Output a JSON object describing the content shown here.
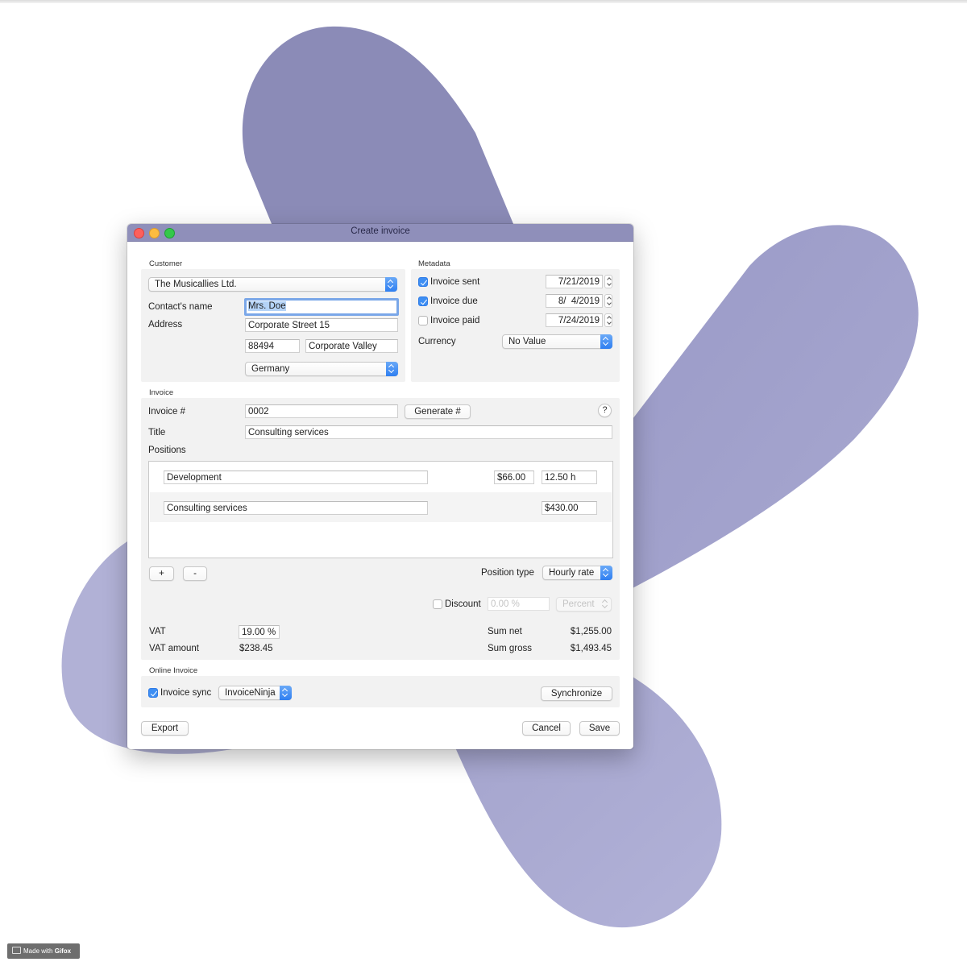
{
  "window": {
    "title": "Create invoice"
  },
  "customer": {
    "section_label": "Customer",
    "selected": "The Musicallies Ltd.",
    "contact_label": "Contact's name",
    "contact_value": "Mrs. Doe",
    "address_label": "Address",
    "street": "Corporate Street 15",
    "zip": "88494",
    "city": "Corporate Valley",
    "country": "Germany"
  },
  "metadata": {
    "section_label": "Metadata",
    "sent": {
      "label": "Invoice sent",
      "checked": true,
      "date": "7/21/2019"
    },
    "due": {
      "label": "Invoice due",
      "checked": true,
      "date": "8/  4/2019"
    },
    "paid": {
      "label": "Invoice paid",
      "checked": false,
      "date": "7/24/2019"
    },
    "currency_label": "Currency",
    "currency_value": "No Value"
  },
  "invoice": {
    "section_label": "Invoice",
    "number_label": "Invoice #",
    "number_value": "0002",
    "generate_button": "Generate #",
    "help_button": "?",
    "title_label": "Title",
    "title_value": "Consulting services",
    "positions_label": "Positions",
    "positions": [
      {
        "description": "Development",
        "rate": "$66.00",
        "quantity": "12.50 h"
      },
      {
        "description": "Consulting services",
        "amount": "$430.00"
      }
    ],
    "add_button": "+",
    "remove_button": "-",
    "position_type_label": "Position type",
    "position_type_value": "Hourly rate",
    "discount_label": "Discount",
    "discount_checked": false,
    "discount_placeholder": "0.00 %",
    "discount_type": "Percent",
    "vat_label": "VAT",
    "vat_value": "19.00 %",
    "vat_amount_label": "VAT amount",
    "vat_amount_value": "$238.45",
    "sum_net_label": "Sum net",
    "sum_net_value": "$1,255.00",
    "sum_gross_label": "Sum gross",
    "sum_gross_value": "$1,493.45"
  },
  "online": {
    "section_label": "Online Invoice",
    "sync_label": "Invoice sync",
    "sync_checked": true,
    "service_value": "InvoiceNinja",
    "synchronize_button": "Synchronize"
  },
  "footer": {
    "export_button": "Export",
    "cancel_button": "Cancel",
    "save_button": "Save"
  },
  "watermark": {
    "prefix": "Made with ",
    "brand": "Gifox"
  },
  "colors": {
    "titlebar": "#8f8fba",
    "shape_dark": "#8d8db8",
    "shape_light": "#a9a9cf",
    "accent": "#3d8ef3"
  }
}
